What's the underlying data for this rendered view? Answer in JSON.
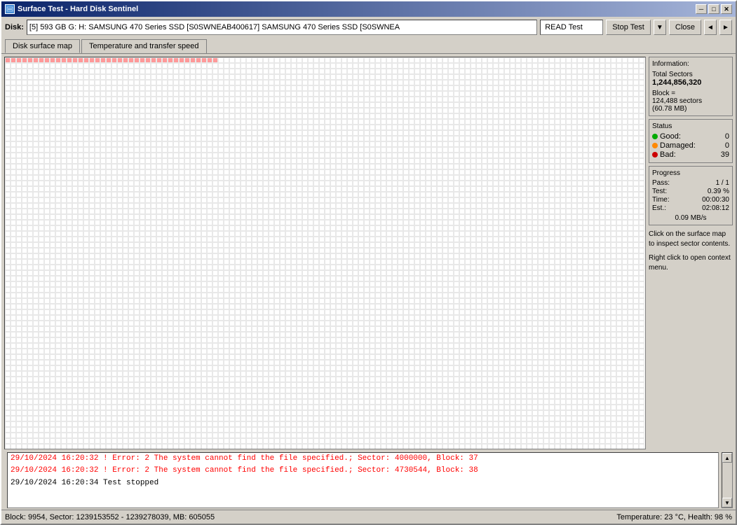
{
  "window": {
    "title": "Surface Test - Hard Disk Sentinel",
    "icon": "disk-icon"
  },
  "title_buttons": {
    "minimize": "─",
    "restore": "□",
    "close": "✕"
  },
  "toolbar": {
    "disk_label": "Disk:",
    "disk_name": "[5] 593 GB G: H: SAMSUNG 470 Series SSD [S0SWNEAB400617] SAMSUNG 470 Series SSD [S0SWNEA",
    "test_type": "READ Test",
    "stop_btn": "Stop Test",
    "dropdown_arrow": "▼",
    "close_btn": "Close",
    "nav_left": "◄",
    "nav_right": "►"
  },
  "tabs": {
    "items": [
      {
        "id": "surface-map",
        "label": "Disk surface map",
        "active": true
      },
      {
        "id": "temp-speed",
        "label": "Temperature and transfer speed",
        "active": false
      }
    ]
  },
  "info_panel": {
    "information_label": "Information:",
    "total_sectors_label": "Total Sectors",
    "total_sectors_value": "1,244,856,320",
    "block_label": "Block =",
    "block_sectors": "124,488 sectors",
    "block_mb": "(60.78 MB)",
    "status_label": "Status",
    "good_label": "Good:",
    "good_value": "0",
    "damaged_label": "Damaged:",
    "damaged_value": "0",
    "bad_label": "Bad:",
    "bad_value": "39",
    "progress_label": "Progress",
    "pass_label": "Pass:",
    "pass_value": "1 / 1",
    "test_label": "Test:",
    "test_value": "0.39 %",
    "time_label": "Time:",
    "time_value": "00:00:30",
    "est_label": "Est.:",
    "est_value": "02:08:12",
    "speed_value": "0.09 MB/s",
    "hint1": "Click on the surface map to inspect sector contents.",
    "hint2": "Right click to open context menu."
  },
  "log": {
    "entries": [
      {
        "type": "error",
        "text": "29/10/2024  16:20:32 ! Error: 2 The system cannot find the file specified.; Sector: 4000000, Block: 37"
      },
      {
        "type": "error",
        "text": "29/10/2024  16:20:32 ! Error: 2 The system cannot find the file specified.; Sector: 4730544, Block: 38"
      },
      {
        "type": "normal",
        "text": "29/10/2024  16:20:34   Test stopped"
      }
    ]
  },
  "status_bar": {
    "left": "Block: 9954, Sector: 1239153552 - 1239278039, MB: 605055",
    "right": "Temperature: 23 °C,  Health: 98 %"
  },
  "colors": {
    "bad_cell": "#ff6666",
    "tested_cell": "#f0f0f0",
    "untested_cell": "#ffffff",
    "grid_border": "#cccccc"
  }
}
